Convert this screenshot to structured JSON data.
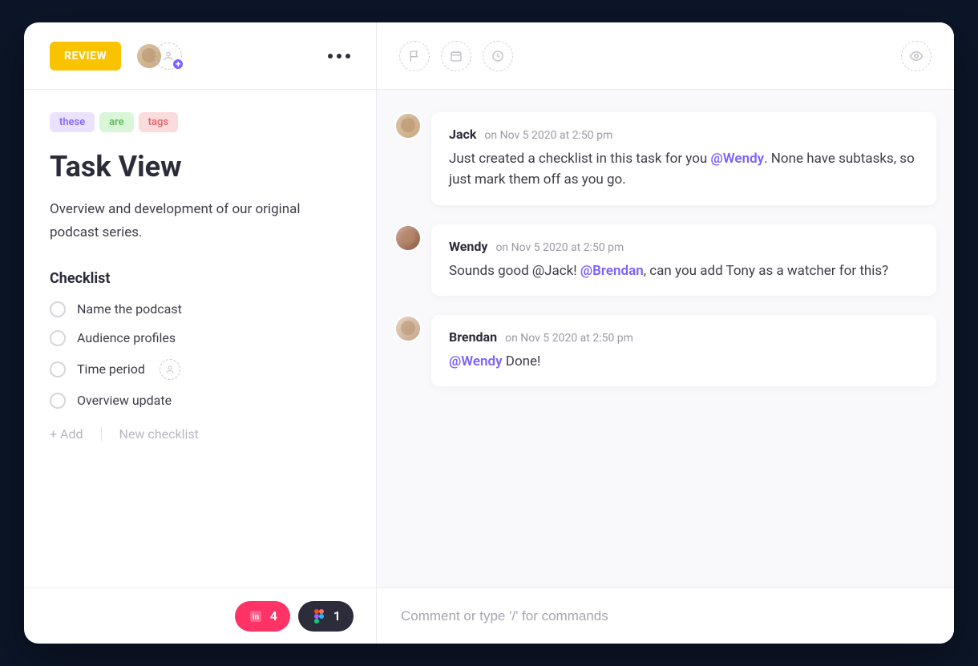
{
  "header": {
    "status": "REVIEW"
  },
  "tags": [
    "these",
    "are",
    "tags"
  ],
  "task": {
    "title": "Task View",
    "description": "Overview and development of our original podcast series."
  },
  "checklist": {
    "title": "Checklist",
    "items": [
      {
        "label": "Name the podcast",
        "assignable": false
      },
      {
        "label": "Audience profiles",
        "assignable": false
      },
      {
        "label": "Time period",
        "assignable": true
      },
      {
        "label": "Overview update",
        "assignable": false
      }
    ],
    "add_label": "+ Add",
    "new_label": "New checklist"
  },
  "footer": {
    "invision_count": "4",
    "figma_count": "1"
  },
  "comments": [
    {
      "author": "Jack",
      "time": "on Nov 5 2020 at 2:50 pm",
      "body_pre": "Just created a checklist in this task for you ",
      "mention": "@Wendy",
      "body_post": ". None have subtasks, so just mark them off as you go."
    },
    {
      "author": "Wendy",
      "time": "on Nov 5 2020 at 2:50 pm",
      "body_pre": "Sounds good @Jack! ",
      "mention": "@Brendan",
      "body_post": ", can you add Tony as a watcher for this?"
    },
    {
      "author": "Brendan",
      "time": "on Nov 5 2020 at 2:50 pm",
      "body_pre": "",
      "mention": "@Wendy",
      "body_post": " Done!"
    }
  ],
  "composer": {
    "placeholder": "Comment or type '/' for commands"
  }
}
